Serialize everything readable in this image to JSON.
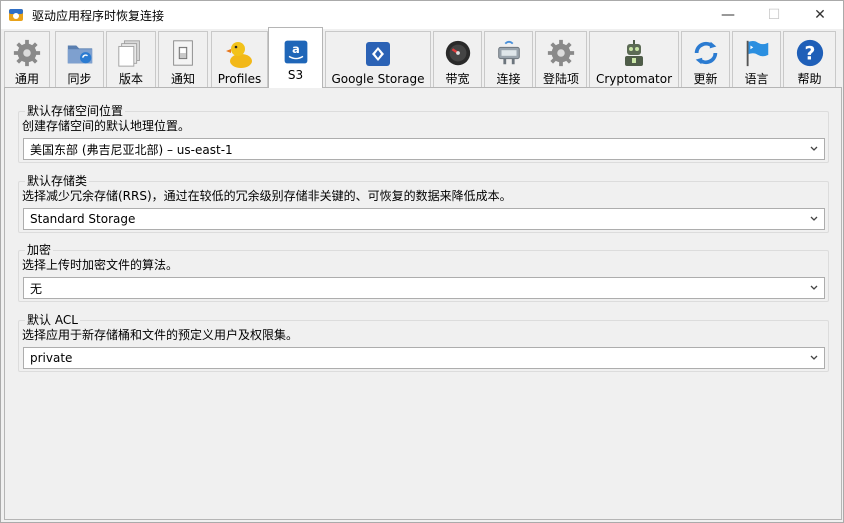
{
  "window": {
    "title": "驱动应用程序时恢复连接",
    "minimize": "—",
    "maximize": "☐",
    "close": "✕"
  },
  "tabs": [
    {
      "label": "通用",
      "icon": "gear-icon"
    },
    {
      "label": "同步",
      "icon": "sync-folder-icon"
    },
    {
      "label": "版本",
      "icon": "documents-icon"
    },
    {
      "label": "通知",
      "icon": "switch-icon"
    },
    {
      "label": "Profiles",
      "icon": "duck-icon"
    },
    {
      "label": "S3",
      "icon": "amazon-s3-icon",
      "active": true
    },
    {
      "label": "Google Storage",
      "icon": "google-storage-icon"
    },
    {
      "label": "带宽",
      "icon": "gauge-icon"
    },
    {
      "label": "连接",
      "icon": "network-icon"
    },
    {
      "label": "登陆项",
      "icon": "gear-login-icon"
    },
    {
      "label": "Cryptomator",
      "icon": "robot-icon"
    },
    {
      "label": "更新",
      "icon": "refresh-icon"
    },
    {
      "label": "语言",
      "icon": "flag-icon"
    },
    {
      "label": "帮助",
      "icon": "help-icon"
    }
  ],
  "settings": {
    "location": {
      "title": "默认存储空间位置",
      "description": "创建存储空间的默认地理位置。",
      "value": "美国东部 (弗吉尼亚北部) – us-east-1"
    },
    "storage_class": {
      "title": "默认存储类",
      "description": "选择减少冗余存储(RRS)，通过在较低的冗余级别存储非关键的、可恢复的数据来降低成本。",
      "value": "Standard Storage"
    },
    "encryption": {
      "title": "加密",
      "description": "选择上传时加密文件的算法。",
      "value": "无"
    },
    "acl": {
      "title": "默认 ACL",
      "description": "选择应用于新存储桶和文件的预定义用户及权限集。",
      "value": "private"
    }
  },
  "colors": {
    "accent_blue": "#2b7bd1",
    "window_bg": "#f0f0f0"
  }
}
